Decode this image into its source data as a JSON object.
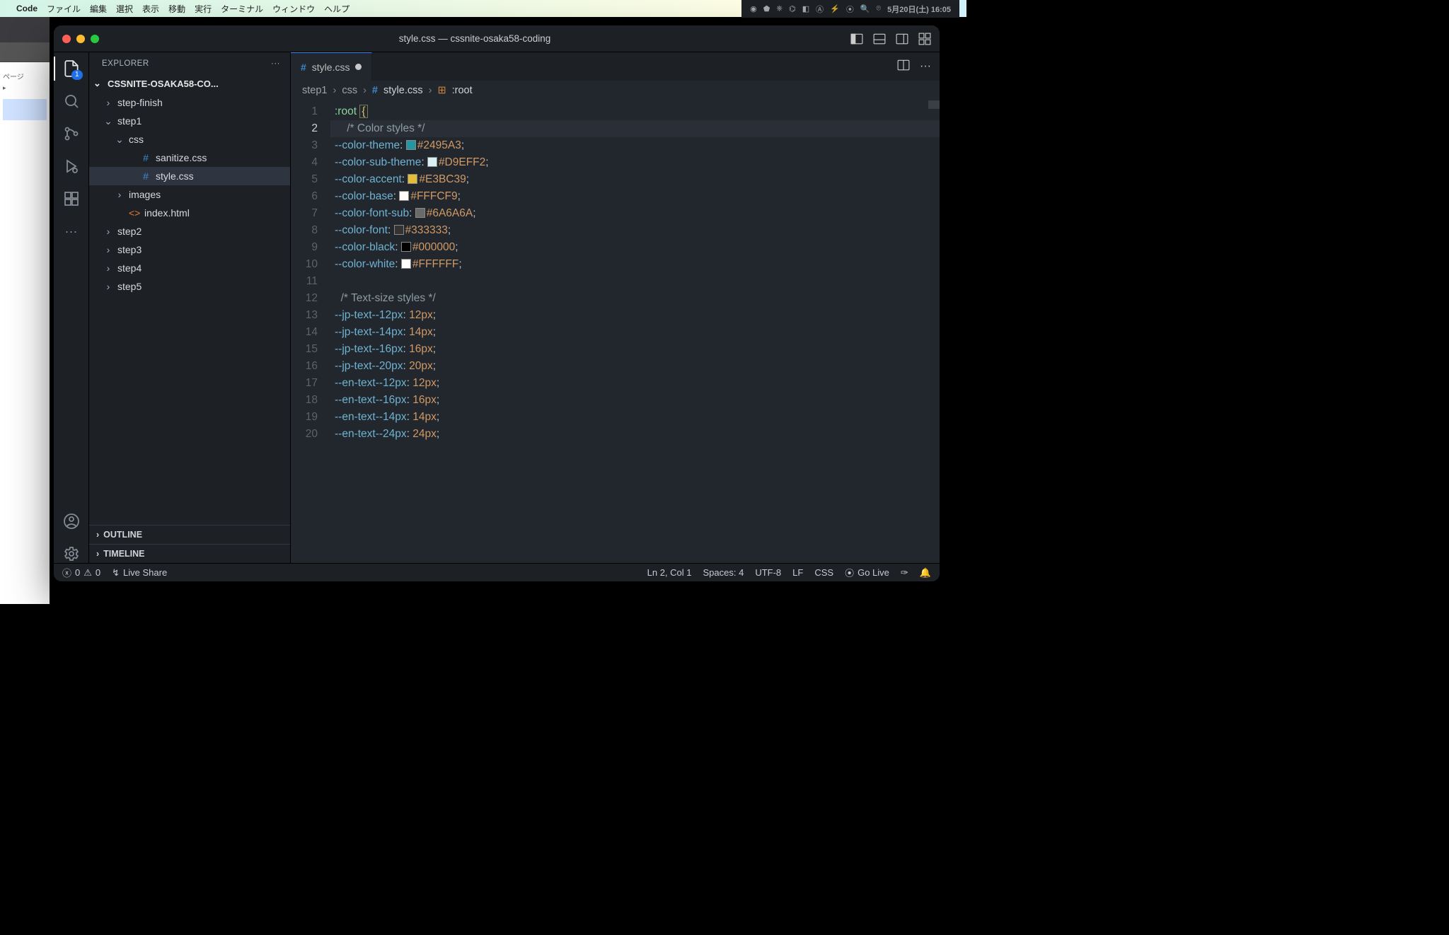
{
  "mac": {
    "appname": "Code",
    "menus": [
      "ファイル",
      "編集",
      "選択",
      "表示",
      "移動",
      "実行",
      "ターミナル",
      "ウィンドウ",
      "ヘルプ"
    ],
    "clock": "5月20日(土) 16:05"
  },
  "window": {
    "title": "style.css — cssnite-osaka58-coding"
  },
  "sidebar": {
    "title": "EXPLORER",
    "project": "CSSNITE-OSAKA58-CO...",
    "tree": [
      {
        "type": "folder",
        "name": "step-finish",
        "depth": 1,
        "open": false
      },
      {
        "type": "folder",
        "name": "step1",
        "depth": 1,
        "open": true
      },
      {
        "type": "folder",
        "name": "css",
        "depth": 2,
        "open": true
      },
      {
        "type": "file",
        "name": "sanitize.css",
        "depth": 3,
        "kind": "css"
      },
      {
        "type": "file",
        "name": "style.css",
        "depth": 3,
        "kind": "css",
        "selected": true
      },
      {
        "type": "folder",
        "name": "images",
        "depth": 2,
        "open": false
      },
      {
        "type": "file",
        "name": "index.html",
        "depth": 2,
        "kind": "html"
      },
      {
        "type": "folder",
        "name": "step2",
        "depth": 1,
        "open": false
      },
      {
        "type": "folder",
        "name": "step3",
        "depth": 1,
        "open": false
      },
      {
        "type": "folder",
        "name": "step4",
        "depth": 1,
        "open": false
      },
      {
        "type": "folder",
        "name": "step5",
        "depth": 1,
        "open": false
      }
    ],
    "outline": "OUTLINE",
    "timeline": "TIMELINE"
  },
  "activity": {
    "explorer_badge": "1"
  },
  "tabs": {
    "active": "style.css"
  },
  "breadcrumbs": [
    "step1",
    "css",
    "style.css",
    ":root"
  ],
  "code": {
    "lines": [
      {
        "n": 1,
        "kind": "sel",
        "text": ":root",
        "brace": "{"
      },
      {
        "n": 2,
        "kind": "comment",
        "text": "/* Color styles */",
        "hl": true,
        "indent": 2
      },
      {
        "n": 3,
        "kind": "color",
        "prop": "--color-theme",
        "hex": "#2495A3"
      },
      {
        "n": 4,
        "kind": "color",
        "prop": "--color-sub-theme",
        "hex": "#D9EFF2"
      },
      {
        "n": 5,
        "kind": "color",
        "prop": "--color-accent",
        "hex": "#E3BC39"
      },
      {
        "n": 6,
        "kind": "color",
        "prop": "--color-base",
        "hex": "#FFFCF9"
      },
      {
        "n": 7,
        "kind": "color",
        "prop": "--color-font-sub",
        "hex": "#6A6A6A"
      },
      {
        "n": 8,
        "kind": "color",
        "prop": "--color-font",
        "hex": "#333333"
      },
      {
        "n": 9,
        "kind": "color",
        "prop": "--color-black",
        "hex": "#000000"
      },
      {
        "n": 10,
        "kind": "color",
        "prop": "--color-white",
        "hex": "#FFFFFF"
      },
      {
        "n": 11,
        "kind": "blank"
      },
      {
        "n": 12,
        "kind": "comment",
        "text": "/* Text-size styles */",
        "indent": 1
      },
      {
        "n": 13,
        "kind": "size",
        "prop": "--jp-text--12px",
        "val": "12px"
      },
      {
        "n": 14,
        "kind": "size",
        "prop": "--jp-text--14px",
        "val": "14px"
      },
      {
        "n": 15,
        "kind": "size",
        "prop": "--jp-text--16px",
        "val": "16px"
      },
      {
        "n": 16,
        "kind": "size",
        "prop": "--jp-text--20px",
        "val": "20px"
      },
      {
        "n": 17,
        "kind": "size",
        "prop": "--en-text--12px",
        "val": "12px"
      },
      {
        "n": 18,
        "kind": "size",
        "prop": "--en-text--16px",
        "val": "16px"
      },
      {
        "n": 19,
        "kind": "size",
        "prop": "--en-text--14px",
        "val": "14px"
      },
      {
        "n": 20,
        "kind": "size",
        "prop": "--en-text--24px",
        "val": "24px"
      }
    ]
  },
  "status": {
    "errors": "0",
    "warnings": "0",
    "liveshare": "Live Share",
    "pos": "Ln 2, Col 1",
    "spaces": "Spaces: 4",
    "enc": "UTF-8",
    "eol": "LF",
    "lang": "CSS",
    "golive": "Go Live"
  }
}
